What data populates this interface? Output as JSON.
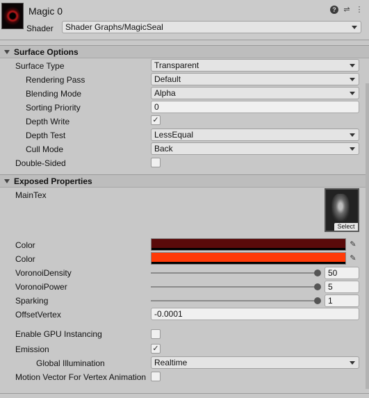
{
  "header": {
    "title": "Magic 0",
    "shader_label": "Shader",
    "shader_value": "Shader Graphs/MagicSeal",
    "icons": [
      "help-icon",
      "settings-sliders-icon",
      "more-menu-icon"
    ]
  },
  "surface_options": {
    "title": "Surface Options",
    "surface_type": {
      "label": "Surface Type",
      "value": "Transparent"
    },
    "rendering_pass": {
      "label": "Rendering Pass",
      "value": "Default"
    },
    "blending_mode": {
      "label": "Blending Mode",
      "value": "Alpha"
    },
    "sorting_priority": {
      "label": "Sorting Priority",
      "value": "0"
    },
    "depth_write": {
      "label": "Depth Write",
      "checked": "✓"
    },
    "depth_test": {
      "label": "Depth Test",
      "value": "LessEqual"
    },
    "cull_mode": {
      "label": "Cull Mode",
      "value": "Back"
    },
    "double_sided": {
      "label": "Double-Sided",
      "checked": ""
    }
  },
  "exposed": {
    "title": "Exposed Properties",
    "maintex": {
      "label": "MainTex",
      "select_label": "Select"
    },
    "color1": {
      "label": "Color",
      "hex": "#5a0a0a"
    },
    "color2": {
      "label": "Color",
      "hex": "#ff3a08"
    },
    "voronoi_density": {
      "label": "VoronoiDensity",
      "value": "50"
    },
    "voronoi_power": {
      "label": "VoronoiPower",
      "value": "5"
    },
    "sparking": {
      "label": "Sparking",
      "value": "1"
    },
    "offset_vertex": {
      "label": "OffsetVertex",
      "value": "-0.0001"
    }
  },
  "advanced": {
    "gpu_instancing": {
      "label": "Enable GPU Instancing",
      "checked": ""
    },
    "emission": {
      "label": "Emission",
      "checked": "✓"
    },
    "global_illumination": {
      "label": "Global Illumination",
      "value": "Realtime"
    },
    "motion_vector": {
      "label": "Motion Vector For Vertex Animation",
      "checked": ""
    }
  }
}
